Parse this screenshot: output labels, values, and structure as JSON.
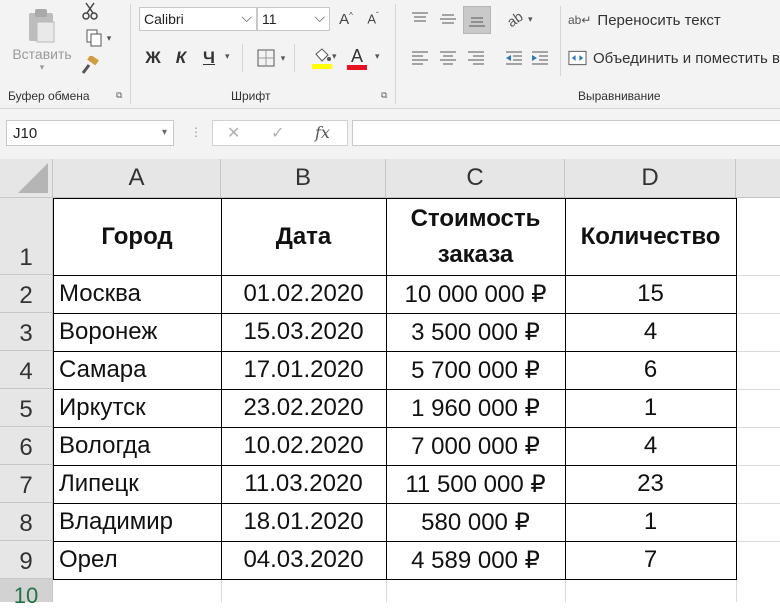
{
  "ribbon": {
    "clipboard": {
      "paste_label": "Вставить",
      "group_label": "Буфер обмена"
    },
    "font": {
      "font_name": "Calibri",
      "font_size": "11",
      "bold_label": "Ж",
      "italic_label": "К",
      "underline_label": "Ч",
      "group_label": "Шрифт"
    },
    "alignment": {
      "wrap_text_label": "Переносить текст",
      "merge_center_label": "Объединить и поместить в",
      "group_label": "Выравнивание"
    }
  },
  "formula_bar": {
    "name_box": "J10",
    "cancel_icon": "✕",
    "enter_icon": "✓",
    "fx_label": "fx",
    "formula": ""
  },
  "sheet": {
    "columns": [
      "A",
      "B",
      "C",
      "D"
    ],
    "row_numbers": [
      "1",
      "2",
      "3",
      "4",
      "5",
      "6",
      "7",
      "8",
      "9",
      "10"
    ],
    "header": {
      "city": "Город",
      "date": "Дата",
      "cost_line1": "Стоимость",
      "cost_line2": "заказа",
      "quantity": "Количество"
    },
    "rows": [
      {
        "city": "Москва",
        "date": "01.02.2020",
        "cost": "10 000 000 ₽",
        "qty": "15"
      },
      {
        "city": "Воронеж",
        "date": "15.03.2020",
        "cost": "3 500 000 ₽",
        "qty": "4"
      },
      {
        "city": "Самара",
        "date": "17.01.2020",
        "cost": "5 700 000 ₽",
        "qty": "6"
      },
      {
        "city": "Иркутск",
        "date": "23.02.2020",
        "cost": "1 960 000 ₽",
        "qty": "1"
      },
      {
        "city": "Вологда",
        "date": "10.02.2020",
        "cost": "7 000 000 ₽",
        "qty": "4"
      },
      {
        "city": "Липецк",
        "date": "11.03.2020",
        "cost": "11 500 000 ₽",
        "qty": "23"
      },
      {
        "city": "Владимир",
        "date": "18.01.2020",
        "cost": "580 000 ₽",
        "qty": "1"
      },
      {
        "city": "Орел",
        "date": "04.03.2020",
        "cost": "4 589 000 ₽",
        "qty": "7"
      }
    ]
  },
  "colors": {
    "highlight_yellow": "#ffff00",
    "font_red": "#e81123"
  }
}
